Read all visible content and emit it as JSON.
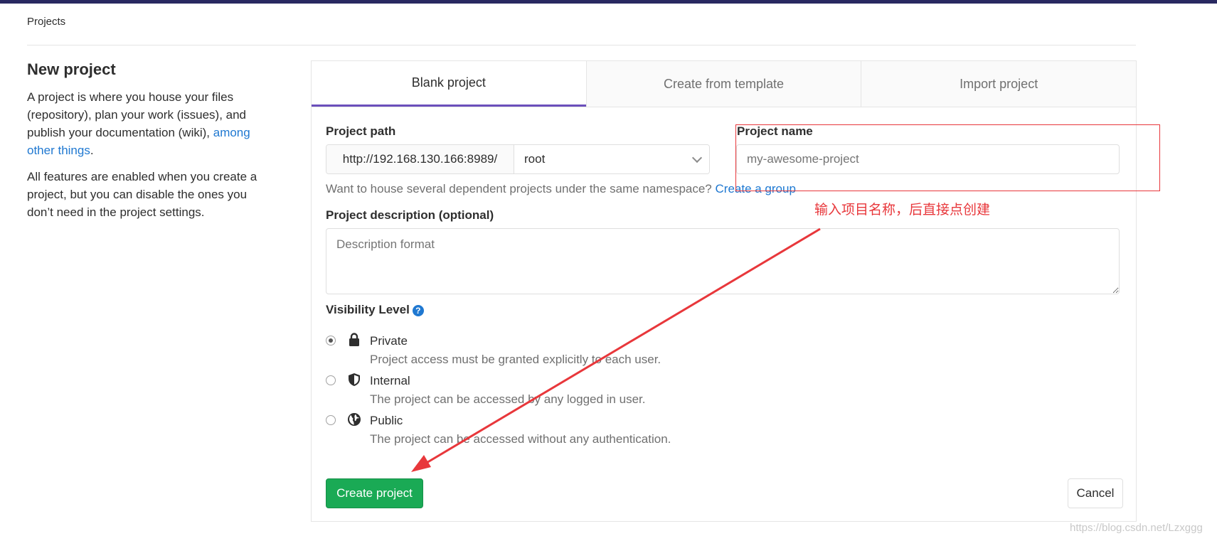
{
  "breadcrumb": {
    "label": "Projects"
  },
  "sidebar": {
    "title": "New project",
    "para1_text": "A project is where you house your files (repository), plan your work (issues), and publish your documentation (wiki), ",
    "para1_link": "among other things",
    "para1_end": ".",
    "para2": "All features are enabled when you create a project, but you can disable the ones you don’t need in the project settings."
  },
  "tabs": [
    {
      "label": "Blank project",
      "active": true
    },
    {
      "label": "Create from template",
      "active": false
    },
    {
      "label": "Import project",
      "active": false
    }
  ],
  "form": {
    "path_label": "Project path",
    "path_prefix": "http://192.168.130.166:8989/",
    "namespace": "root",
    "name_label": "Project name",
    "name_placeholder": "my-awesome-project",
    "hint_text": "Want to house several dependent projects under the same namespace? ",
    "hint_link": "Create a group",
    "desc_label": "Project description (optional)",
    "desc_placeholder": "Description format",
    "visibility_label": "Visibility Level",
    "help_glyph": "?"
  },
  "visibility": [
    {
      "title": "Private",
      "desc": "Project access must be granted explicitly to each user.",
      "checked": true,
      "icon": "lock-icon"
    },
    {
      "title": "Internal",
      "desc": "The project can be accessed by any logged in user.",
      "checked": false,
      "icon": "shield-icon"
    },
    {
      "title": "Public",
      "desc": "The project can be accessed without any authentication.",
      "checked": false,
      "icon": "globe-icon"
    }
  ],
  "buttons": {
    "create": "Create project",
    "cancel": "Cancel"
  },
  "annotation": {
    "text": "输入项目名称，后直接点创建",
    "color": "#e8373b"
  },
  "watermark": "https://blog.csdn.net/Lzxggg",
  "colors": {
    "brand_bar": "#292961",
    "accent_tab": "#6b4fbb",
    "create_green": "#1aaa55",
    "link_blue": "#1f78d1"
  }
}
